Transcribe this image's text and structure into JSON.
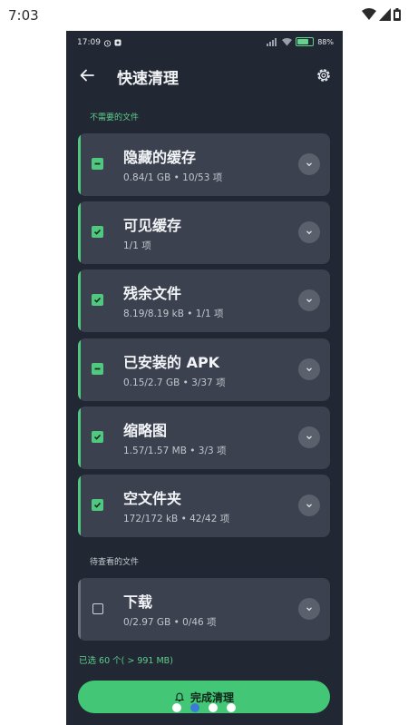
{
  "device_status": {
    "time": "7:03"
  },
  "inner_status": {
    "time": "17:09",
    "battery": "88%"
  },
  "header": {
    "title": "快速清理"
  },
  "sections": {
    "unneeded": "不需要的文件",
    "review": "待查看的文件"
  },
  "items": [
    {
      "title": "隐藏的缓存",
      "subtitle": "0.84/1 GB • 10/53 项",
      "state": "partial"
    },
    {
      "title": "可见缓存",
      "subtitle": "1/1 项",
      "state": "checked"
    },
    {
      "title": "残余文件",
      "subtitle": "8.19/8.19 kB • 1/1 项",
      "state": "checked"
    },
    {
      "title": "已安装的 APK",
      "subtitle": "0.15/2.7 GB • 3/37 项",
      "state": "partial"
    },
    {
      "title": "缩略图",
      "subtitle": "1.57/1.57 MB • 3/3 项",
      "state": "checked"
    },
    {
      "title": "空文件夹",
      "subtitle": "172/172 kB • 42/42 项",
      "state": "checked"
    }
  ],
  "review_items": [
    {
      "title": "下载",
      "subtitle": "0/2.97 GB • 0/46 项",
      "state": "unchecked"
    }
  ],
  "footer": {
    "selected_summary": "已选 60 个( > 991 MB)",
    "finish_label": "完成清理"
  },
  "colors": {
    "background": "#212733",
    "card": "#3b414e",
    "accent": "#4fc97f"
  }
}
